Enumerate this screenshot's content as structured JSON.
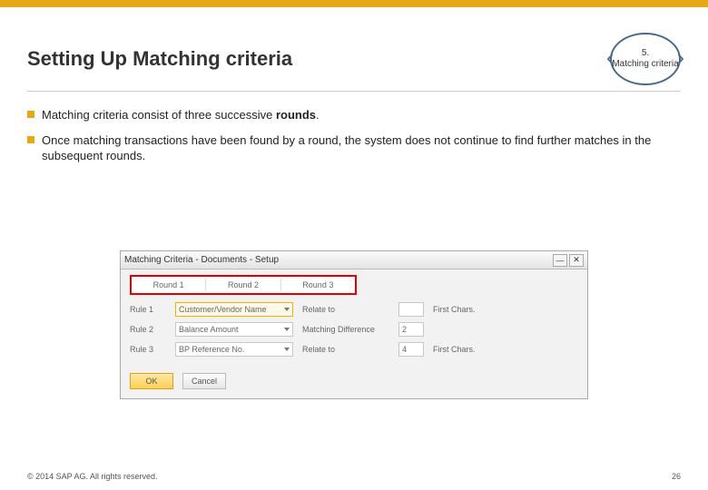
{
  "header": {
    "title": "Setting Up Matching criteria",
    "badge_number": "5.",
    "badge_text": "Matching criteria"
  },
  "bullets": [
    {
      "pre": "Matching criteria consist of three successive ",
      "bold": "rounds",
      "post": "."
    },
    {
      "pre": "Once matching transactions have been found by a round, the system does not continue to find further matches in the subsequent rounds.",
      "bold": "",
      "post": ""
    }
  ],
  "panel": {
    "title": "Matching Criteria - Documents - Setup",
    "tabs": [
      "Round 1",
      "Round 2",
      "Round 3"
    ],
    "rules": [
      {
        "label": "Rule 1",
        "value": "Customer/Vendor Name",
        "mid": "Relate to",
        "input": "",
        "trail": "First Chars."
      },
      {
        "label": "Rule 2",
        "value": "Balance Amount",
        "mid": "Matching Difference",
        "input": "2",
        "trail": ""
      },
      {
        "label": "Rule 3",
        "value": "BP Reference No.",
        "mid": "Relate to",
        "input": "4",
        "trail": "First Chars."
      }
    ],
    "buttons": {
      "ok": "OK",
      "cancel": "Cancel"
    }
  },
  "footer": {
    "copyright": "© 2014 SAP AG. All rights reserved.",
    "page": "26"
  }
}
